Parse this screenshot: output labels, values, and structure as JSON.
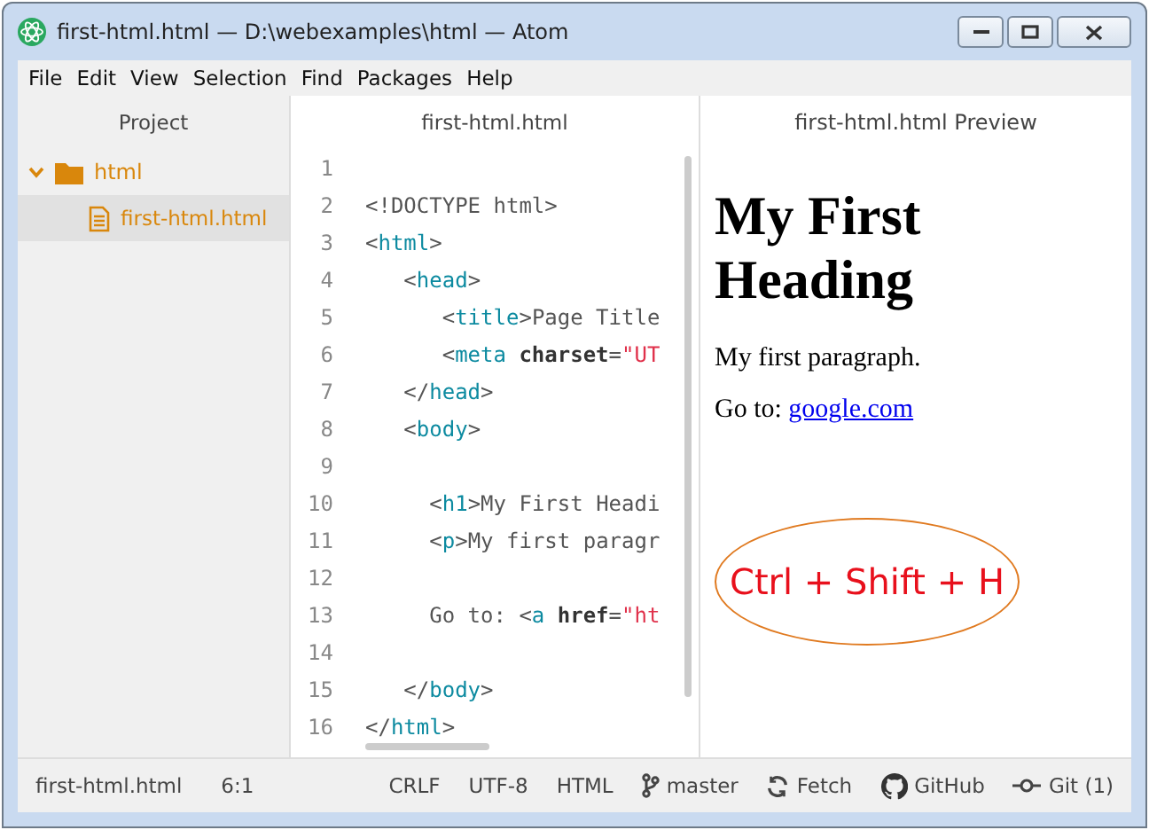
{
  "window": {
    "title": "first-html.html — D:\\webexamples\\html — Atom"
  },
  "menu": [
    "File",
    "Edit",
    "View",
    "Selection",
    "Find",
    "Packages",
    "Help"
  ],
  "sidebar": {
    "title": "Project",
    "tree": [
      {
        "label": "html",
        "kind": "folder",
        "expanded": true,
        "selected": false,
        "children": [
          {
            "label": "first-html.html",
            "kind": "file",
            "selected": true
          }
        ]
      }
    ]
  },
  "editor": {
    "tab": "first-html.html",
    "lines": [
      {
        "number": "1"
      },
      {
        "number": "2",
        "segments": [
          {
            "text": "<!DOCTYPE ",
            "kind": "punct"
          },
          {
            "text": "html",
            "kind": "text"
          },
          {
            "text": ">",
            "kind": "punct"
          }
        ]
      },
      {
        "number": "3",
        "segments": [
          {
            "text": "<",
            "kind": "punct"
          },
          {
            "text": "html",
            "kind": "tag"
          },
          {
            "text": ">",
            "kind": "punct"
          }
        ]
      },
      {
        "number": "4",
        "segments": [
          {
            "text": "   <",
            "kind": "punct"
          },
          {
            "text": "head",
            "kind": "tag"
          },
          {
            "text": ">",
            "kind": "punct"
          }
        ]
      },
      {
        "number": "5",
        "segments": [
          {
            "text": "      <",
            "kind": "punct"
          },
          {
            "text": "title",
            "kind": "tag"
          },
          {
            "text": ">",
            "kind": "punct"
          },
          {
            "text": "Page Title",
            "kind": "text"
          }
        ]
      },
      {
        "number": "6",
        "segments": [
          {
            "text": "      <",
            "kind": "punct"
          },
          {
            "text": "meta ",
            "kind": "tag"
          },
          {
            "text": "charset",
            "kind": "attr"
          },
          {
            "text": "=",
            "kind": "text"
          },
          {
            "text": "\"UT",
            "kind": "string"
          }
        ]
      },
      {
        "number": "7",
        "segments": [
          {
            "text": "   </",
            "kind": "punct"
          },
          {
            "text": "head",
            "kind": "tag"
          },
          {
            "text": ">",
            "kind": "punct"
          }
        ]
      },
      {
        "number": "8",
        "segments": [
          {
            "text": "   <",
            "kind": "punct"
          },
          {
            "text": "body",
            "kind": "tag"
          },
          {
            "text": ">",
            "kind": "punct"
          }
        ]
      },
      {
        "number": "9"
      },
      {
        "number": "10",
        "segments": [
          {
            "text": "     <",
            "kind": "punct"
          },
          {
            "text": "h1",
            "kind": "tag"
          },
          {
            "text": ">",
            "kind": "punct"
          },
          {
            "text": "My First Headi",
            "kind": "text"
          }
        ]
      },
      {
        "number": "11",
        "segments": [
          {
            "text": "     <",
            "kind": "punct"
          },
          {
            "text": "p",
            "kind": "tag"
          },
          {
            "text": ">",
            "kind": "punct"
          },
          {
            "text": "My first paragr",
            "kind": "text"
          }
        ]
      },
      {
        "number": "12"
      },
      {
        "number": "13",
        "segments": [
          {
            "text": "     Go to: <",
            "kind": "text"
          },
          {
            "text": "a ",
            "kind": "tag"
          },
          {
            "text": "href",
            "kind": "attr"
          },
          {
            "text": "=",
            "kind": "text"
          },
          {
            "text": "\"ht",
            "kind": "string"
          }
        ]
      },
      {
        "number": "14"
      },
      {
        "number": "15",
        "segments": [
          {
            "text": "   </",
            "kind": "punct"
          },
          {
            "text": "body",
            "kind": "tag"
          },
          {
            "text": ">",
            "kind": "punct"
          }
        ]
      },
      {
        "number": "16",
        "segments": [
          {
            "text": "</",
            "kind": "punct"
          },
          {
            "text": "html",
            "kind": "tag"
          },
          {
            "text": ">",
            "kind": "punct"
          }
        ]
      }
    ]
  },
  "preview": {
    "tab": "first-html.html Preview",
    "heading": "My First Heading",
    "paragraph": "My first paragraph.",
    "link_prefix": "Go to:",
    "link": "google.com",
    "annotation": "Ctrl + Shift + H"
  },
  "status_bar": {
    "left": [
      "first-html.html",
      "6:1"
    ],
    "right": [
      {
        "text": "CRLF",
        "kind": "plain"
      },
      {
        "text": "UTF-8",
        "kind": "plain"
      },
      {
        "text": "HTML",
        "kind": "plain"
      },
      {
        "text": "master",
        "kind": "branch"
      },
      {
        "text": "Fetch",
        "kind": "fetch"
      },
      {
        "text": "GitHub",
        "kind": "github"
      },
      {
        "text": "Git (1)",
        "kind": "git"
      }
    ]
  }
}
